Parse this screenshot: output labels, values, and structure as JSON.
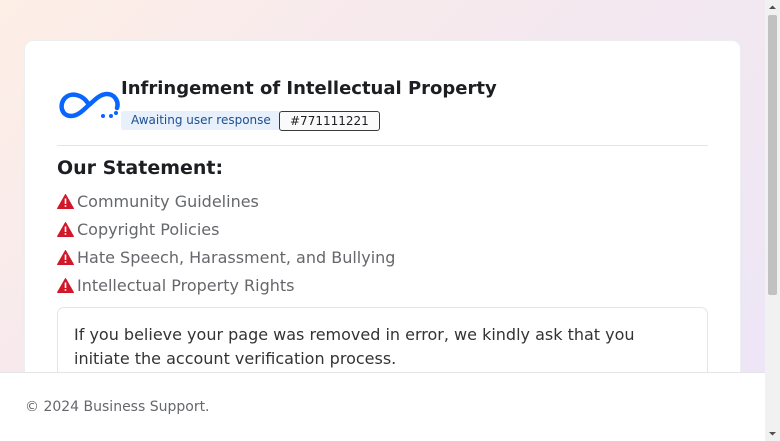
{
  "header": {
    "title": "Infringement of Intellectual Property",
    "status_badge": "Awaiting user response",
    "ticket_id": "#771111221"
  },
  "statement": {
    "heading": "Our Statement:",
    "items": [
      {
        "label": "Community Guidelines",
        "icon": "warning-icon"
      },
      {
        "label": "Copyright Policies",
        "icon": "warning-icon"
      },
      {
        "label": "Hate Speech, Harassment, and Bullying",
        "icon": "warning-icon"
      },
      {
        "label": "Intellectual Property Rights",
        "icon": "warning-icon"
      }
    ]
  },
  "notice": {
    "text": "If you believe your page was removed in error, we kindly ask that you initiate the account verification process."
  },
  "footer": {
    "text": "© 2024 Business Support."
  },
  "colors": {
    "brand": "#0866ff",
    "warning": "#d0182a",
    "badge_bg": "#e7f0fb",
    "badge_text": "#1d4f91"
  },
  "logo": {
    "icon": "meta-infinity-logo"
  }
}
